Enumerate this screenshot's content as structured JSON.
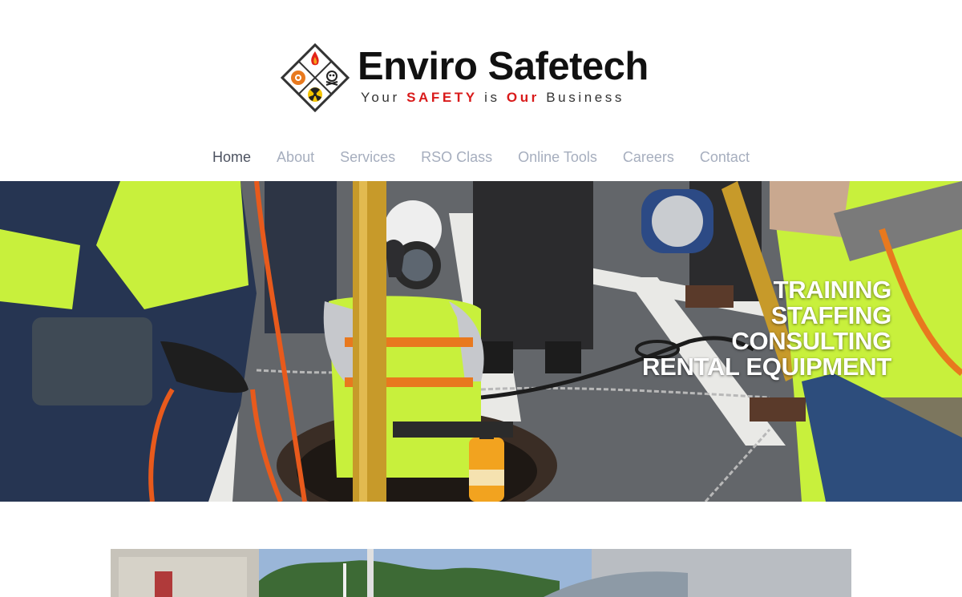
{
  "brand": {
    "name": "Enviro Safetech",
    "tagline_parts": [
      "Your ",
      "SAFETY",
      " is ",
      "Our",
      " Business"
    ],
    "accent_color": "#d91b1b"
  },
  "nav": {
    "items": [
      {
        "label": "Home",
        "active": true
      },
      {
        "label": "About"
      },
      {
        "label": "Services"
      },
      {
        "label": "RSO Class"
      },
      {
        "label": "Online Tools"
      },
      {
        "label": "Careers"
      },
      {
        "label": "Contact"
      }
    ]
  },
  "hero": {
    "lines": [
      "TRAINING",
      "STAFFING",
      "CONSULTING",
      "RENTAL EQUIPMENT"
    ]
  }
}
